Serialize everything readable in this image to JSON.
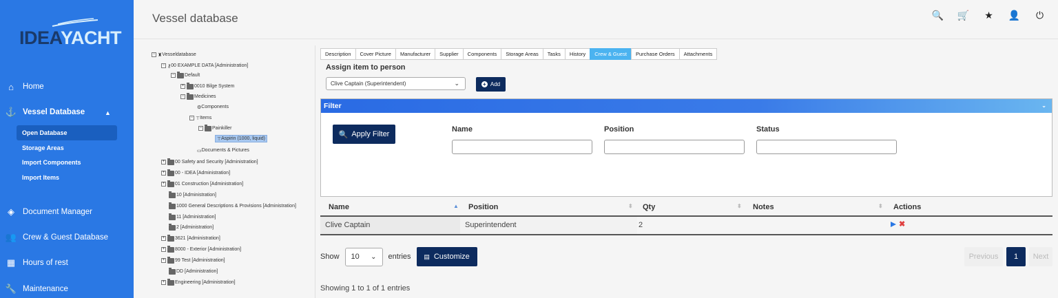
{
  "brand": {
    "logo_part1": "IDEA",
    "logo_part2": "YACHT"
  },
  "sidebar": {
    "items": [
      {
        "label": "Home"
      },
      {
        "label": "Vessel Database"
      },
      {
        "label": "Document Manager"
      },
      {
        "label": "Crew & Guest Database"
      },
      {
        "label": "Hours of rest"
      },
      {
        "label": "Maintenance"
      }
    ],
    "subitems": [
      {
        "label": "Open Database"
      },
      {
        "label": "Storage Areas"
      },
      {
        "label": "Import Components"
      },
      {
        "label": "Import Items"
      }
    ]
  },
  "header": {
    "title": "Vessel database"
  },
  "tree": {
    "root": "Vesseldatabase",
    "example": "00 EXAMPLE DATA [Administration]",
    "default": "Default",
    "bilge": "0010 Bilge System",
    "medicines": "Medicines",
    "components": "Components",
    "items": "Items",
    "painkiller": "Painkiller",
    "aspirin": "Aspirin (1000, liquid)",
    "docs": "Documents & Pictures",
    "folders": [
      "00 Safety and Security [Administration]",
      "00 - IDEA [Administration]",
      "01 Construction [Administration]",
      "10 [Administration]",
      "1000 General Descriptions & Provisions [Administration]",
      "11 [Administration]",
      "2 [Administration]",
      "3621 [Administration]",
      "8000 - Exterior [Administration]",
      "99 Test [Administration]",
      "DD [Administration]",
      "Engineering [Administration]"
    ]
  },
  "tabs": [
    "Description",
    "Cover Picture",
    "Manufacturer",
    "Supplier",
    "Components",
    "Storage Areas",
    "Tasks",
    "History",
    "Crew & Guest",
    "Purchase Orders",
    "Attachments"
  ],
  "assign": {
    "label": "Assign item to person",
    "selected": "Clive Captain (Superintendent)",
    "add_label": "Add"
  },
  "filter": {
    "title": "Filter",
    "apply_label": "Apply Filter",
    "name_label": "Name",
    "position_label": "Position",
    "status_label": "Status"
  },
  "table": {
    "headers": {
      "name": "Name",
      "position": "Position",
      "qty": "Qty",
      "notes": "Notes",
      "actions": "Actions"
    },
    "rows": [
      {
        "name": "Clive Captain",
        "position": "Superintendent",
        "qty": "2",
        "notes": ""
      }
    ]
  },
  "footer": {
    "show": "Show",
    "length": "10",
    "entries": "entries",
    "customize": "Customize",
    "previous": "Previous",
    "page": "1",
    "next": "Next",
    "info": "Showing 1 to 1 of 1 entries"
  },
  "colors": {
    "sidebar": "#2a78e4",
    "primary_button": "#0d2b5e",
    "active_tab": "#4bb3f0"
  }
}
